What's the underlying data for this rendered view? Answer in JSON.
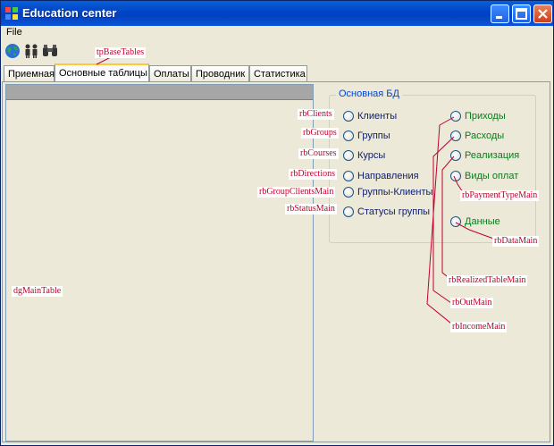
{
  "window": {
    "title": "Education center"
  },
  "menu": {
    "file": "File"
  },
  "toolbar": {
    "icons": [
      "globe-icon",
      "people-icon",
      "binoculars-icon"
    ]
  },
  "tabs": [
    "Приемная",
    "Основные таблицы",
    "Оплаты",
    "Проводник",
    "Статистика"
  ],
  "active_tab": 1,
  "groupbox": {
    "title": "Основная БД"
  },
  "radios_left": [
    "Клиенты",
    "Группы",
    "Курсы",
    "Направления",
    "Группы-Клиенты",
    "Статусы группы"
  ],
  "radios_right": [
    "Приходы",
    "Расходы",
    "Реализация",
    "Виды оплат",
    "Данные"
  ],
  "annotations": {
    "tpBaseTables": "tpBaseTables",
    "rbClients": "rbClients",
    "rbGroups": "rbGroups",
    "rbCourses": "rbCourses",
    "rbDirections": "rbDirections",
    "rbGroupClientsMain": "rbGroupClientsMain",
    "rbStatusMain": "rbStatusMain",
    "dgMainTable": "dgMainTable",
    "rbPaymentTypeMain": "rbPaymentTypeMain",
    "rbDataMain": "rbDataMain",
    "rbRealizedTableMain": "rbRealizedTableMain",
    "rbOutMain": "rbOutMain",
    "rbIncomeMain": "rbIncomeMain"
  },
  "colors": {
    "titlebar": "#0046c8",
    "annotation": "#c0002a",
    "legend": "#0046d5",
    "left_labels": "#10206e",
    "right_labels": "#0d7a1e"
  }
}
